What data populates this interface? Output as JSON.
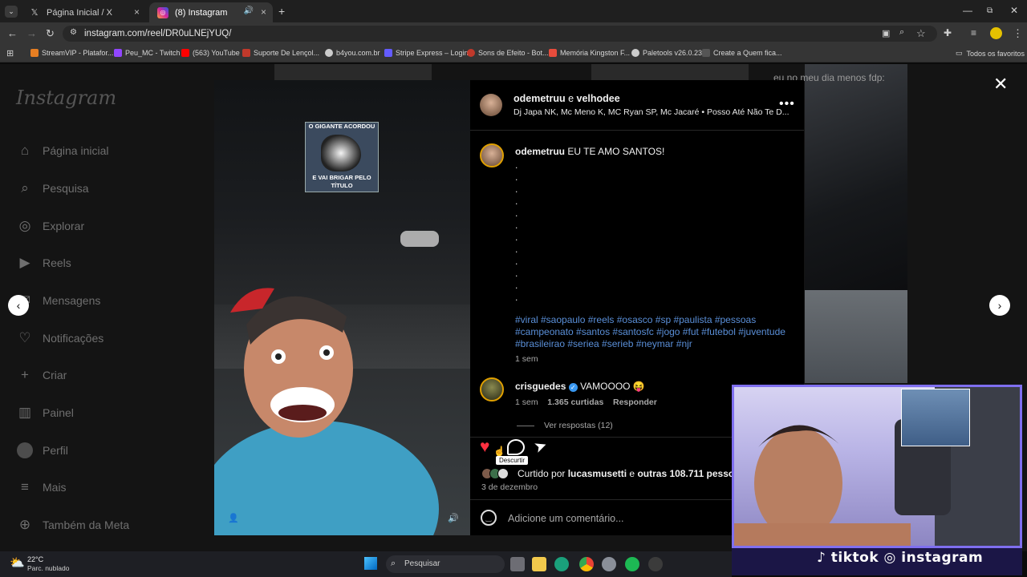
{
  "browser": {
    "tabs": [
      {
        "title": "Página Inicial / X",
        "icon": "x-logo-icon"
      },
      {
        "title": "(8) Instagram",
        "icon": "instagram-icon",
        "active": true
      }
    ],
    "url": "instagram.com/reel/DR0uLNEjYUQ/",
    "bookmarks": [
      {
        "label": "StreamVIP - Platafor...",
        "color": "#e67e22"
      },
      {
        "label": "Peu_MC - Twitch",
        "color": "#9146ff"
      },
      {
        "label": "(563) YouTube",
        "color": "#ff0000"
      },
      {
        "label": "Suporte De Lençol...",
        "color": "#c0392b"
      },
      {
        "label": "b4you.com.br",
        "color": "#cccccc"
      },
      {
        "label": "Stripe Express – Login",
        "color": "#635bff"
      },
      {
        "label": "Sons de Efeito - Bot...",
        "color": "#c0392b"
      },
      {
        "label": "Memória Kingston F...",
        "color": "#e74c3c"
      },
      {
        "label": "Paletools v26.0.23",
        "color": "#cccccc"
      },
      {
        "label": "Create a Quem fica...",
        "color": "#333333"
      }
    ],
    "all_favorites": "Todos os favoritos"
  },
  "sidebar": {
    "logo": "Instagram",
    "items": [
      {
        "label": "Página inicial",
        "icon": "home-icon"
      },
      {
        "label": "Pesquisa",
        "icon": "search-icon"
      },
      {
        "label": "Explorar",
        "icon": "compass-icon"
      },
      {
        "label": "Reels",
        "icon": "reels-icon"
      },
      {
        "label": "Mensagens",
        "icon": "messenger-icon"
      },
      {
        "label": "Notificações",
        "icon": "heart-icon"
      },
      {
        "label": "Criar",
        "icon": "plus-icon"
      },
      {
        "label": "Painel",
        "icon": "dashboard-icon"
      },
      {
        "label": "Perfil",
        "icon": "avatar-icon"
      },
      {
        "label": "Mais",
        "icon": "menu-icon"
      },
      {
        "label": "Também da Meta",
        "icon": "meta-icon"
      }
    ]
  },
  "background": {
    "caption": "eu no meu dia menos fdp:"
  },
  "post": {
    "meme_top": "O GIGANTE ACORDOU",
    "meme_bottom": "E VAI BRIGAR PELO TÍTULO",
    "author": "odemetruu",
    "conjunction": "e",
    "coauthor": "velhodee",
    "audio": "Dj Japa NK, Mc Meno K, MC Ryan SP, Mc Jacaré • Posso Até Não Te D...",
    "caption_user": "odemetruu",
    "caption_text": "EU TE AMO SANTOS!",
    "hashtags_line1": "#viral #saopaulo #reels #osasco #sp #paulista #pessoas",
    "hashtags_line2": "#campeonato #santos #santosfc #jogo #fut #futebol #juventude",
    "hashtags_line3": "#brasileirao #seriea #serieb #neymar #njr",
    "caption_time": "1 sem",
    "comment_user": "crisguedes",
    "comment_text": "VAMOOOO 😝",
    "comment_time": "1 sem",
    "comment_likes": "1.365 curtidas",
    "reply_label": "Responder",
    "view_replies": "Ver respostas (12)",
    "tooltip": "Descurtir",
    "liked_prefix": "Curtido por",
    "liked_user": "lucasmusetti",
    "liked_mid": "e",
    "liked_others": "outras 108.711 pessoas",
    "date": "3 de dezembro",
    "comment_placeholder": "Adicione um comentário..."
  },
  "overlay": {
    "social": "♪ tiktok ◎ instagram"
  },
  "taskbar": {
    "temp": "22°C",
    "weather": "Parc. nublado",
    "search": "Pesquisar"
  },
  "colors": {
    "liked_heart": "#ff3040",
    "link": "#5a8fd8",
    "cam_border": "#7f6ff0"
  }
}
